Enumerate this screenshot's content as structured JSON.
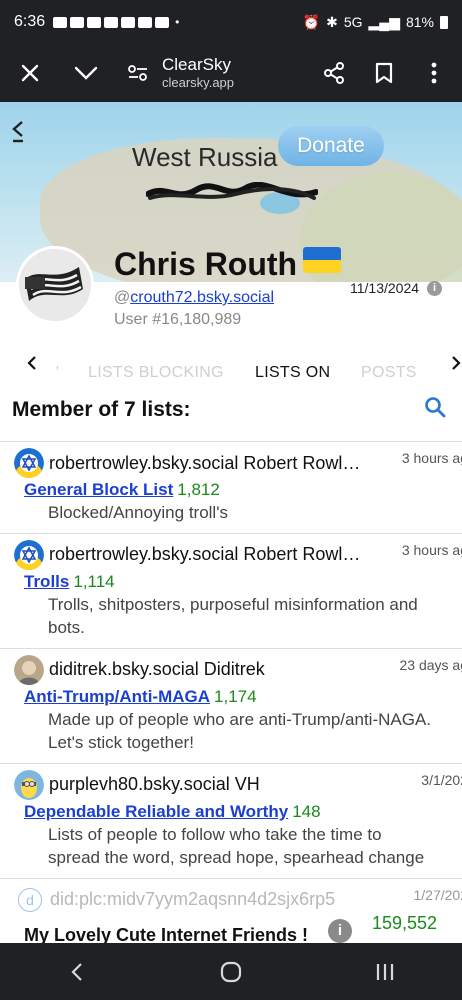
{
  "status_bar": {
    "time": "6:36",
    "network": "5G",
    "battery": "81%"
  },
  "browser": {
    "title": "ClearSky",
    "url": "clearsky.app",
    "icons": [
      "close-icon",
      "chevron-down-icon",
      "site-settings-icon",
      "share-icon",
      "bookmark-icon",
      "more-vertical-icon"
    ]
  },
  "hero": {
    "map_text": "West Russia",
    "donate_label": "Donate"
  },
  "profile": {
    "name": "Chris Routh",
    "handle_prefix": "@",
    "handle": "crouth72.bsky.social",
    "user_number": "User #16,180,989",
    "date": "11/13/2024",
    "info_label": "i"
  },
  "tabs": {
    "items": [
      "LISTS BLOCKING",
      "LISTS ON",
      "POSTS"
    ],
    "active": "LISTS ON",
    "left_fragment": "'"
  },
  "section": {
    "title": "Member of 7 lists:"
  },
  "lists": [
    {
      "owner": "robertrowley.bsky.social Robert Rowl…",
      "time": "3 hours ag",
      "name": "General Block List",
      "count": "1,812",
      "description": "Blocked/Annoying troll's"
    },
    {
      "owner": "robertrowley.bsky.social Robert Rowl…",
      "time": "3 hours ag",
      "name": "Trolls",
      "count": "1,114",
      "description": "Trolls, shitposters, purposeful misinformation and bots."
    },
    {
      "owner": "diditrek.bsky.social Diditrek",
      "time": "23 days ag",
      "name": "Anti-Trump/Anti-MAGA",
      "count": "1,174",
      "description": "Made up of people who are anti-Trump/anti-NAGA. Let's stick together!"
    },
    {
      "owner": "purplevh80.bsky.social VH",
      "time": "3/1/202",
      "name": "Dependable Reliable and Worthy",
      "count": "148",
      "description": "Lists of people to follow who take the time to spread the word, spread hope, spearhead change"
    },
    {
      "owner": "did:plc:midv7yym2aqsnn4d2sjx6rp5",
      "time": "1/27/202",
      "avatar_letter": "d",
      "name": "My Lovely Cute Internet Friends !",
      "count": "159,552",
      "info_label": "i"
    }
  ],
  "colors": {
    "link": "#1a3fd1",
    "count": "#1a8a1a",
    "system_bar": "#202124",
    "donate": "#7fbdea"
  }
}
